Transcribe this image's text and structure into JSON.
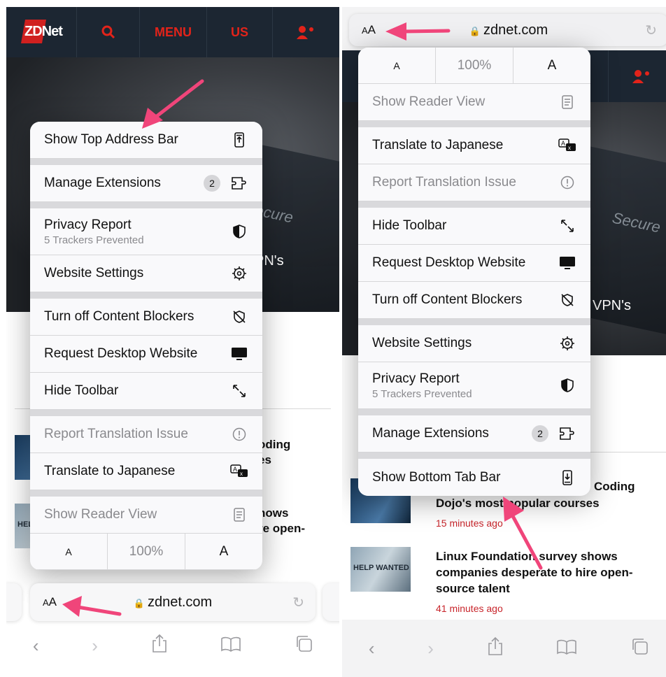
{
  "header": {
    "logo": "ZDNet",
    "menu": "MENU",
    "region": "US"
  },
  "hero": {
    "left_text": "PN's",
    "right_text": "VPN's"
  },
  "articles": [
    {
      "title_fragment_left": "oding",
      "title_fragment_left_2": "es",
      "title_line1": "Coding",
      "title_line2": "Dojo's most popular courses",
      "time": "15 minutes ago"
    },
    {
      "title_fragment_left": "hows",
      "title_fragment_left_2": "re open-",
      "title_line1": "Linux Foundation survey shows",
      "title_line2": "companies desperate to hire open-",
      "title_line3": "source talent",
      "time": "41 minutes ago",
      "thumb_label": "HELP WANTED"
    }
  ],
  "left_menu": {
    "items": [
      {
        "label": "Show Top Address Bar",
        "icon": "address-bar-top-icon"
      },
      {
        "label": "Manage Extensions",
        "badge": "2",
        "icon": "extensions-icon"
      },
      {
        "label": "Privacy Report",
        "sub": "5 Trackers Prevented",
        "icon": "shield-icon"
      },
      {
        "label": "Website Settings",
        "icon": "gear-icon"
      },
      {
        "label": "Turn off Content Blockers",
        "icon": "blocker-off-icon"
      },
      {
        "label": "Request Desktop Website",
        "icon": "desktop-icon"
      },
      {
        "label": "Hide Toolbar",
        "icon": "expand-arrows-icon"
      },
      {
        "label": "Report Translation Issue",
        "icon": "exclamation-icon"
      },
      {
        "label": "Translate to Japanese",
        "icon": "translate-icon"
      },
      {
        "label": "Show Reader View",
        "icon": "reader-icon"
      }
    ],
    "zoom": {
      "small": "A",
      "percent": "100%",
      "large": "A"
    }
  },
  "right_menu": {
    "zoom": {
      "small": "A",
      "percent": "100%",
      "large": "A"
    },
    "items": [
      {
        "label": "Show Reader View",
        "icon": "reader-icon"
      },
      {
        "label": "Translate to Japanese",
        "icon": "translate-icon"
      },
      {
        "label": "Report Translation Issue",
        "icon": "exclamation-icon"
      },
      {
        "label": "Hide Toolbar",
        "icon": "expand-arrows-icon"
      },
      {
        "label": "Request Desktop Website",
        "icon": "desktop-icon"
      },
      {
        "label": "Turn off Content Blockers",
        "icon": "blocker-off-icon"
      },
      {
        "label": "Website Settings",
        "icon": "gear-icon"
      },
      {
        "label": "Privacy Report",
        "sub": "5 Trackers Prevented",
        "icon": "shield-icon"
      },
      {
        "label": "Manage Extensions",
        "badge": "2",
        "icon": "extensions-icon"
      },
      {
        "label": "Show Bottom Tab Bar",
        "icon": "address-bar-bottom-icon"
      }
    ]
  },
  "address_bar": {
    "aa_small": "A",
    "aa_large": "A",
    "url": "zdnet.com"
  },
  "colors": {
    "accent": "#e2231a",
    "arrow": "#f0457a",
    "header": "#1c2632"
  }
}
